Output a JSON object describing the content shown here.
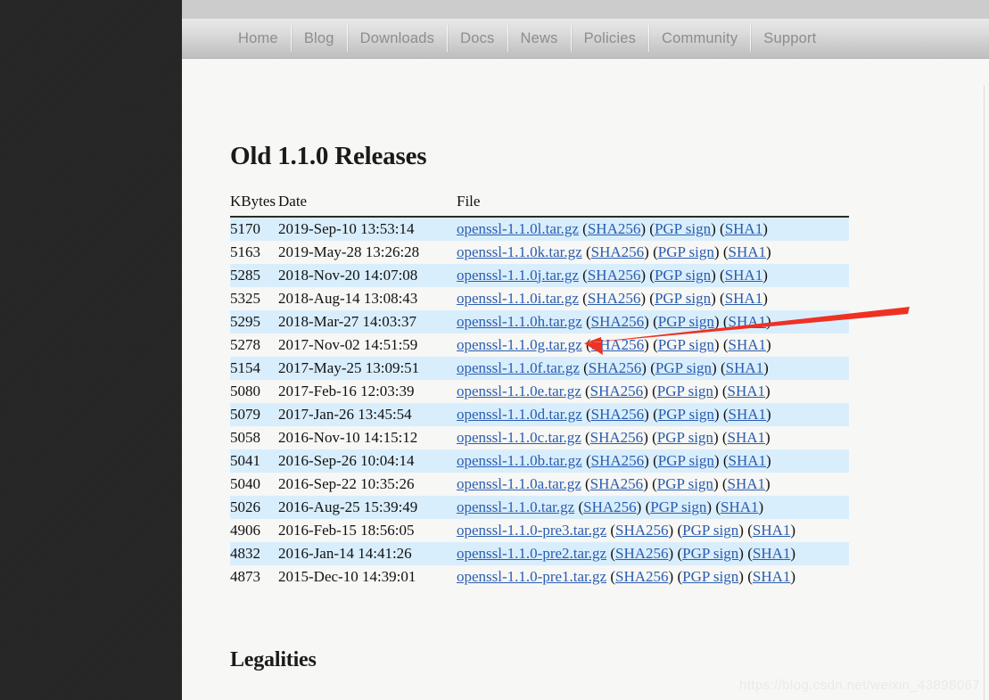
{
  "browser": {
    "watermark": "https://blog.csdn.net/weixin_43898067"
  },
  "nav": {
    "items": [
      {
        "label": "Home"
      },
      {
        "label": "Blog"
      },
      {
        "label": "Downloads"
      },
      {
        "label": "Docs"
      },
      {
        "label": "News"
      },
      {
        "label": "Policies"
      },
      {
        "label": "Community"
      },
      {
        "label": "Support"
      }
    ]
  },
  "page": {
    "heading_releases": "Old 1.1.0 Releases",
    "heading_legalities": "Legalities"
  },
  "table": {
    "columns": [
      "KBytes",
      "Date",
      "File"
    ],
    "link_labels": {
      "sha256": "SHA256",
      "pgp": "PGP sign",
      "sha1": "SHA1"
    },
    "rows": [
      {
        "kbytes": "5170",
        "date": "2019-Sep-10 13:53:14",
        "file": "openssl-1.1.0l.tar.gz"
      },
      {
        "kbytes": "5163",
        "date": "2019-May-28 13:26:28",
        "file": "openssl-1.1.0k.tar.gz"
      },
      {
        "kbytes": "5285",
        "date": "2018-Nov-20 14:07:08",
        "file": "openssl-1.1.0j.tar.gz"
      },
      {
        "kbytes": "5325",
        "date": "2018-Aug-14 13:08:43",
        "file": "openssl-1.1.0i.tar.gz"
      },
      {
        "kbytes": "5295",
        "date": "2018-Mar-27 14:03:37",
        "file": "openssl-1.1.0h.tar.gz"
      },
      {
        "kbytes": "5278",
        "date": "2017-Nov-02 14:51:59",
        "file": "openssl-1.1.0g.tar.gz"
      },
      {
        "kbytes": "5154",
        "date": "2017-May-25 13:09:51",
        "file": "openssl-1.1.0f.tar.gz"
      },
      {
        "kbytes": "5080",
        "date": "2017-Feb-16 12:03:39",
        "file": "openssl-1.1.0e.tar.gz"
      },
      {
        "kbytes": "5079",
        "date": "2017-Jan-26 13:45:54",
        "file": "openssl-1.1.0d.tar.gz"
      },
      {
        "kbytes": "5058",
        "date": "2016-Nov-10 14:15:12",
        "file": "openssl-1.1.0c.tar.gz"
      },
      {
        "kbytes": "5041",
        "date": "2016-Sep-26 10:04:14",
        "file": "openssl-1.1.0b.tar.gz"
      },
      {
        "kbytes": "5040",
        "date": "2016-Sep-22 10:35:26",
        "file": "openssl-1.1.0a.tar.gz"
      },
      {
        "kbytes": "5026",
        "date": "2016-Aug-25 15:39:49",
        "file": "openssl-1.1.0.tar.gz"
      },
      {
        "kbytes": "4906",
        "date": "2016-Feb-15 18:56:05",
        "file": "openssl-1.1.0-pre3.tar.gz"
      },
      {
        "kbytes": "4832",
        "date": "2016-Jan-14 14:41:26",
        "file": "openssl-1.1.0-pre2.tar.gz"
      },
      {
        "kbytes": "4873",
        "date": "2015-Dec-10 14:39:01",
        "file": "openssl-1.1.0-pre1.tar.gz"
      }
    ]
  },
  "annotation": {
    "arrow_color": "#ef3124",
    "target_row_file": "openssl-1.1.0g.tar.gz"
  }
}
